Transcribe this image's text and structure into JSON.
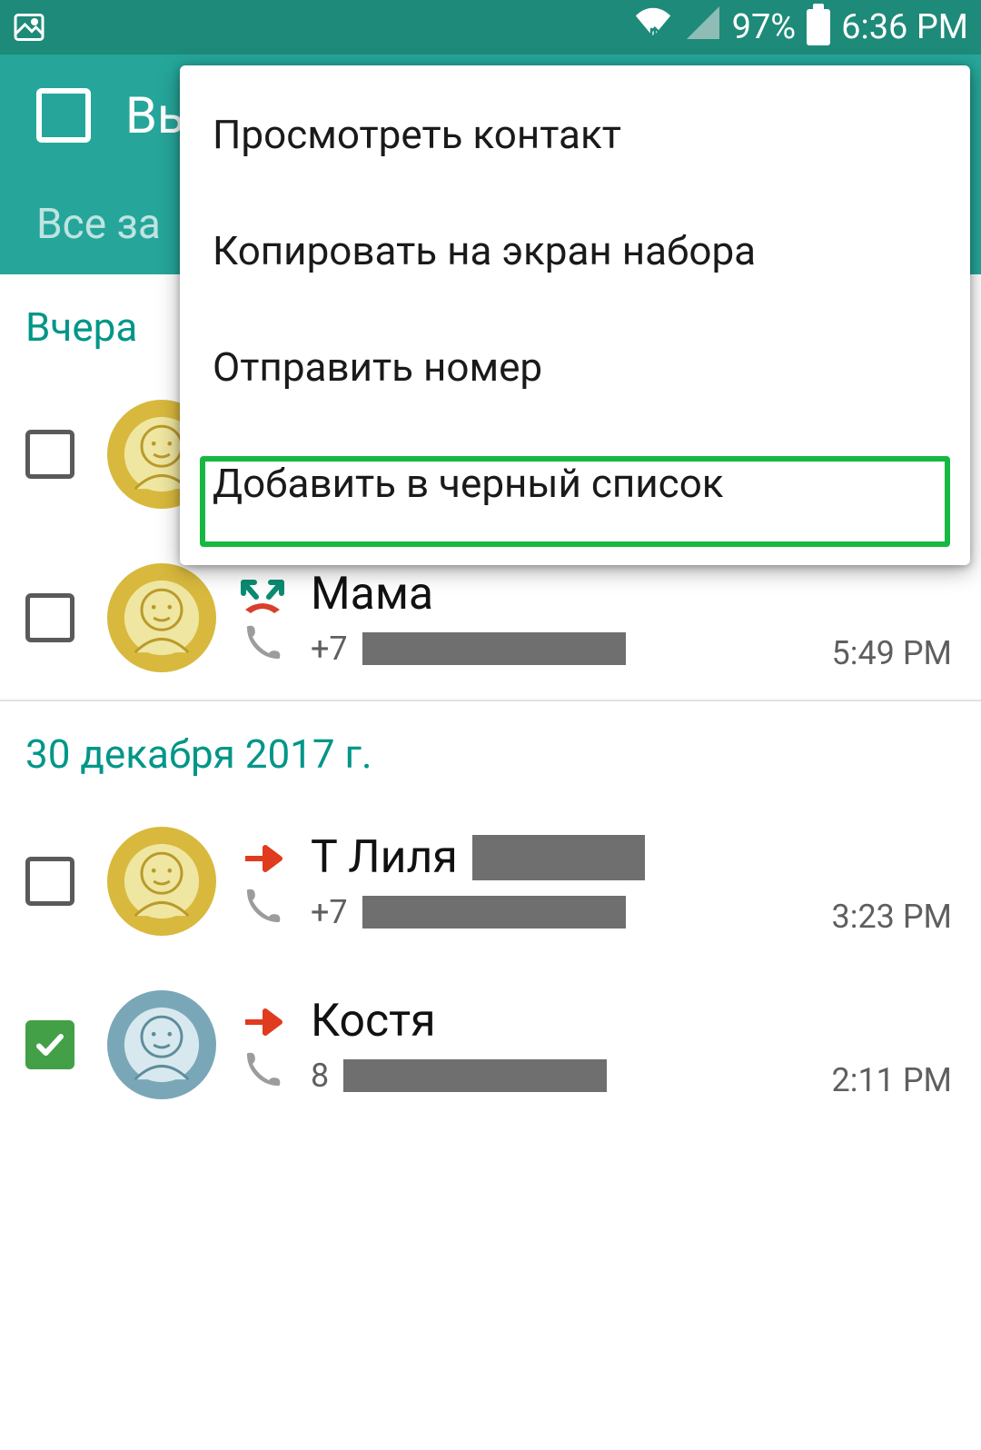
{
  "status": {
    "battery_pct": "97%",
    "time": "6:36 PM"
  },
  "header": {
    "title": "Вы",
    "tab": "Все за"
  },
  "sections": [
    {
      "label": "Вчера",
      "rows": [
        {
          "name": "",
          "prefix": "",
          "time": "",
          "checked": false,
          "avatar": "yellow",
          "callType": "none"
        },
        {
          "name": "Мама",
          "prefix": "+7",
          "time": "5:49 PM",
          "checked": false,
          "avatar": "yellow",
          "callType": "missed"
        }
      ]
    },
    {
      "label": "30 декабря 2017 г.",
      "rows": [
        {
          "name": "Т Лиля",
          "prefix": "+7",
          "time": "3:23 PM",
          "checked": false,
          "avatar": "yellow",
          "callType": "out"
        },
        {
          "name": "Костя",
          "prefix": "8",
          "time": "2:11 PM",
          "checked": true,
          "avatar": "blue",
          "callType": "out"
        }
      ]
    }
  ],
  "menu": {
    "items": [
      "Просмотреть контакт",
      "Копировать на экран набора",
      "Отправить номер",
      "Добавить в черный список"
    ]
  }
}
